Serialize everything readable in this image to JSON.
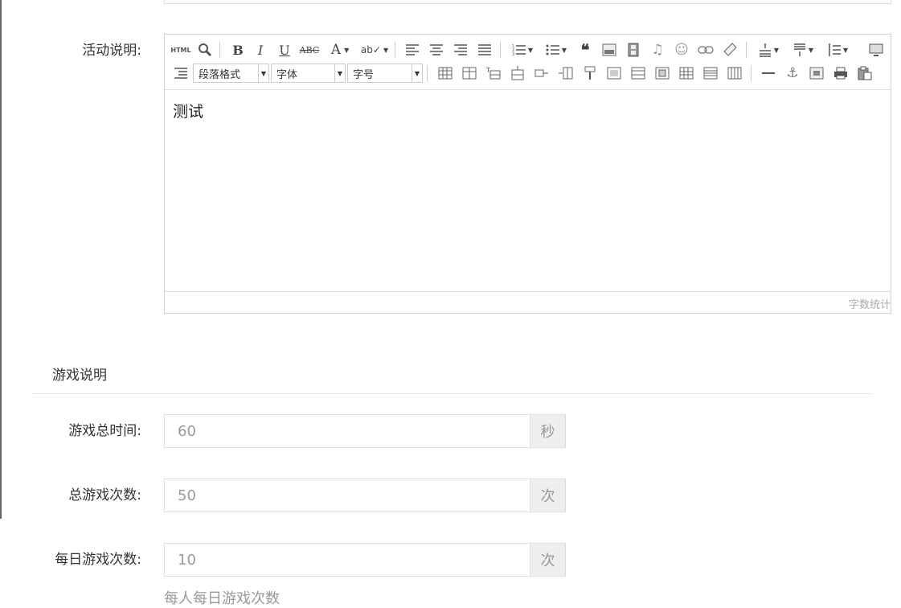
{
  "activity": {
    "label": "活动说明:",
    "editor": {
      "combos": {
        "paragraph": "段落格式",
        "font": "字体",
        "size": "字号"
      },
      "content_text": "测试",
      "word_count_label": "字数统计",
      "html_button": "HTML"
    }
  },
  "game_section": {
    "title": "游戏说明",
    "fields": [
      {
        "label": "游戏总时间:",
        "value": "60",
        "unit": "秒"
      },
      {
        "label": "总游戏次数:",
        "value": "50",
        "unit": "次"
      },
      {
        "label": "每日游戏次数:",
        "value": "10",
        "unit": "次"
      }
    ],
    "daily_help": "每人每日游戏次数"
  }
}
